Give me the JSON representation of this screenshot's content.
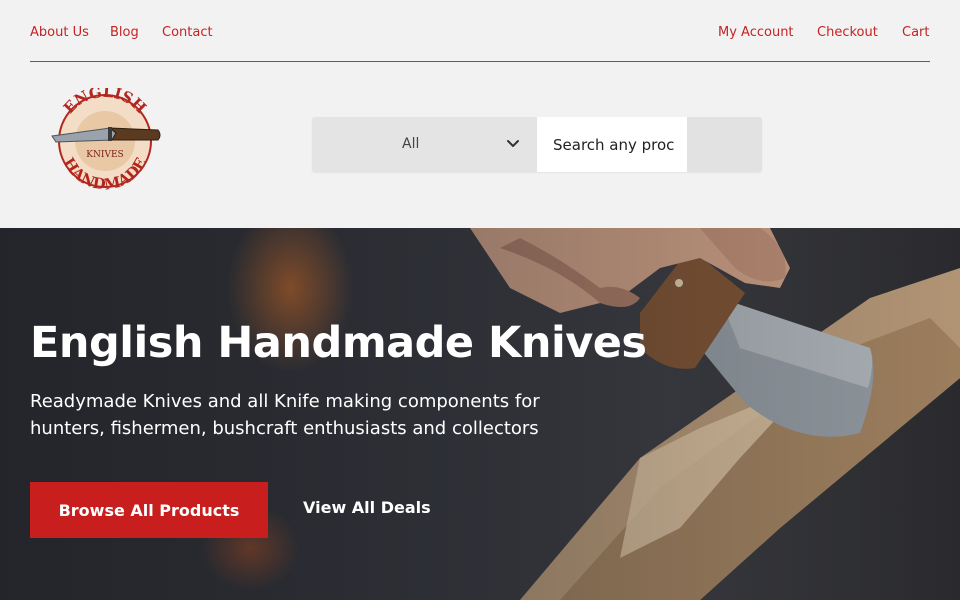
{
  "topnav": {
    "left": [
      {
        "label": "About Us"
      },
      {
        "label": "Blog"
      },
      {
        "label": "Contact"
      }
    ],
    "right": [
      {
        "label": "My Account"
      },
      {
        "label": "Checkout"
      },
      {
        "label": "Cart"
      }
    ]
  },
  "logo": {
    "top_text": "ENGLISH",
    "middle_text": "KNIVES",
    "bottom_text": "HANDMADE"
  },
  "search": {
    "category_selected": "All",
    "placeholder": "Search any proc"
  },
  "hero": {
    "title": "English Handmade Knives",
    "subtitle_line1": "Readymade Knives and all Knife making components for",
    "subtitle_line2": "hunters, fishermen, bushcraft enthusiasts and collectors",
    "primary_button": "Browse All Products",
    "secondary_link": "View All Deals"
  },
  "colors": {
    "accent": "#c81e1e",
    "nav_link": "#c42424",
    "header_bg": "#f2f2f2"
  }
}
